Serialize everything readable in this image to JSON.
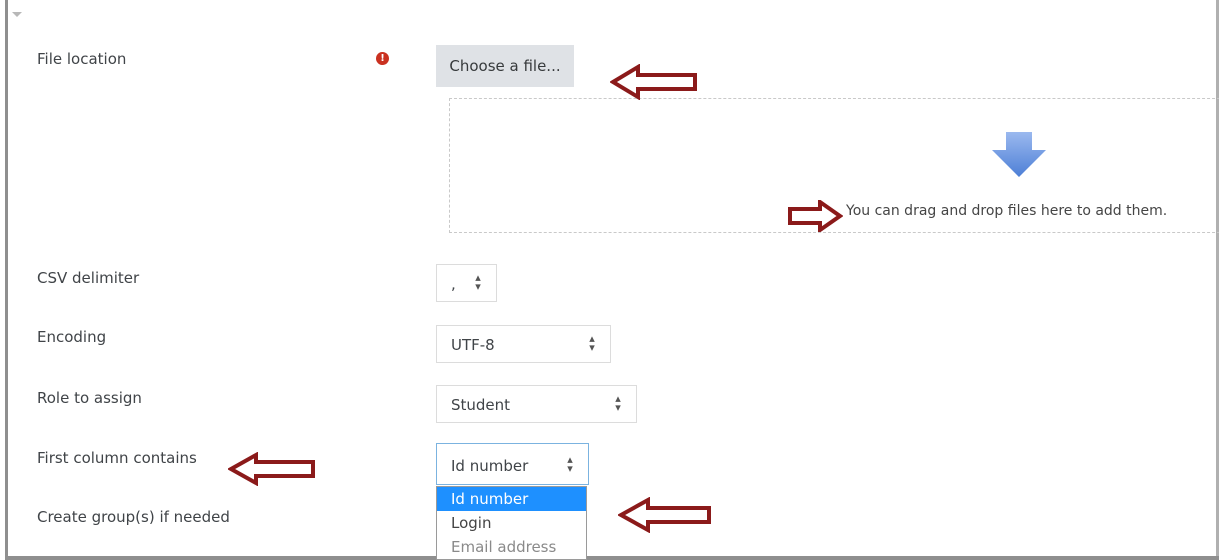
{
  "fields": {
    "file_location": {
      "label": "File location",
      "required_icon": "!",
      "choose_button": "Choose a file...",
      "dropzone_text": "You can drag and drop files here to add them."
    },
    "csv_delimiter": {
      "label": "CSV delimiter",
      "value": ","
    },
    "encoding": {
      "label": "Encoding",
      "value": "UTF-8"
    },
    "role": {
      "label": "Role to assign",
      "value": "Student"
    },
    "first_column": {
      "label": "First column contains",
      "value": "Id number",
      "options": [
        "Id number",
        "Login",
        "Email address"
      ]
    },
    "create_groups": {
      "label": "Create group(s) if needed"
    }
  },
  "colors": {
    "annotation_arrow": "#8b1a1a",
    "selected_option": "#1e90ff",
    "button_bg": "#dfe2e6",
    "required_icon": "#ca3120"
  },
  "icons": [
    "collapse-caret-icon",
    "required-icon",
    "down-arrow-icon",
    "updown-icon"
  ]
}
